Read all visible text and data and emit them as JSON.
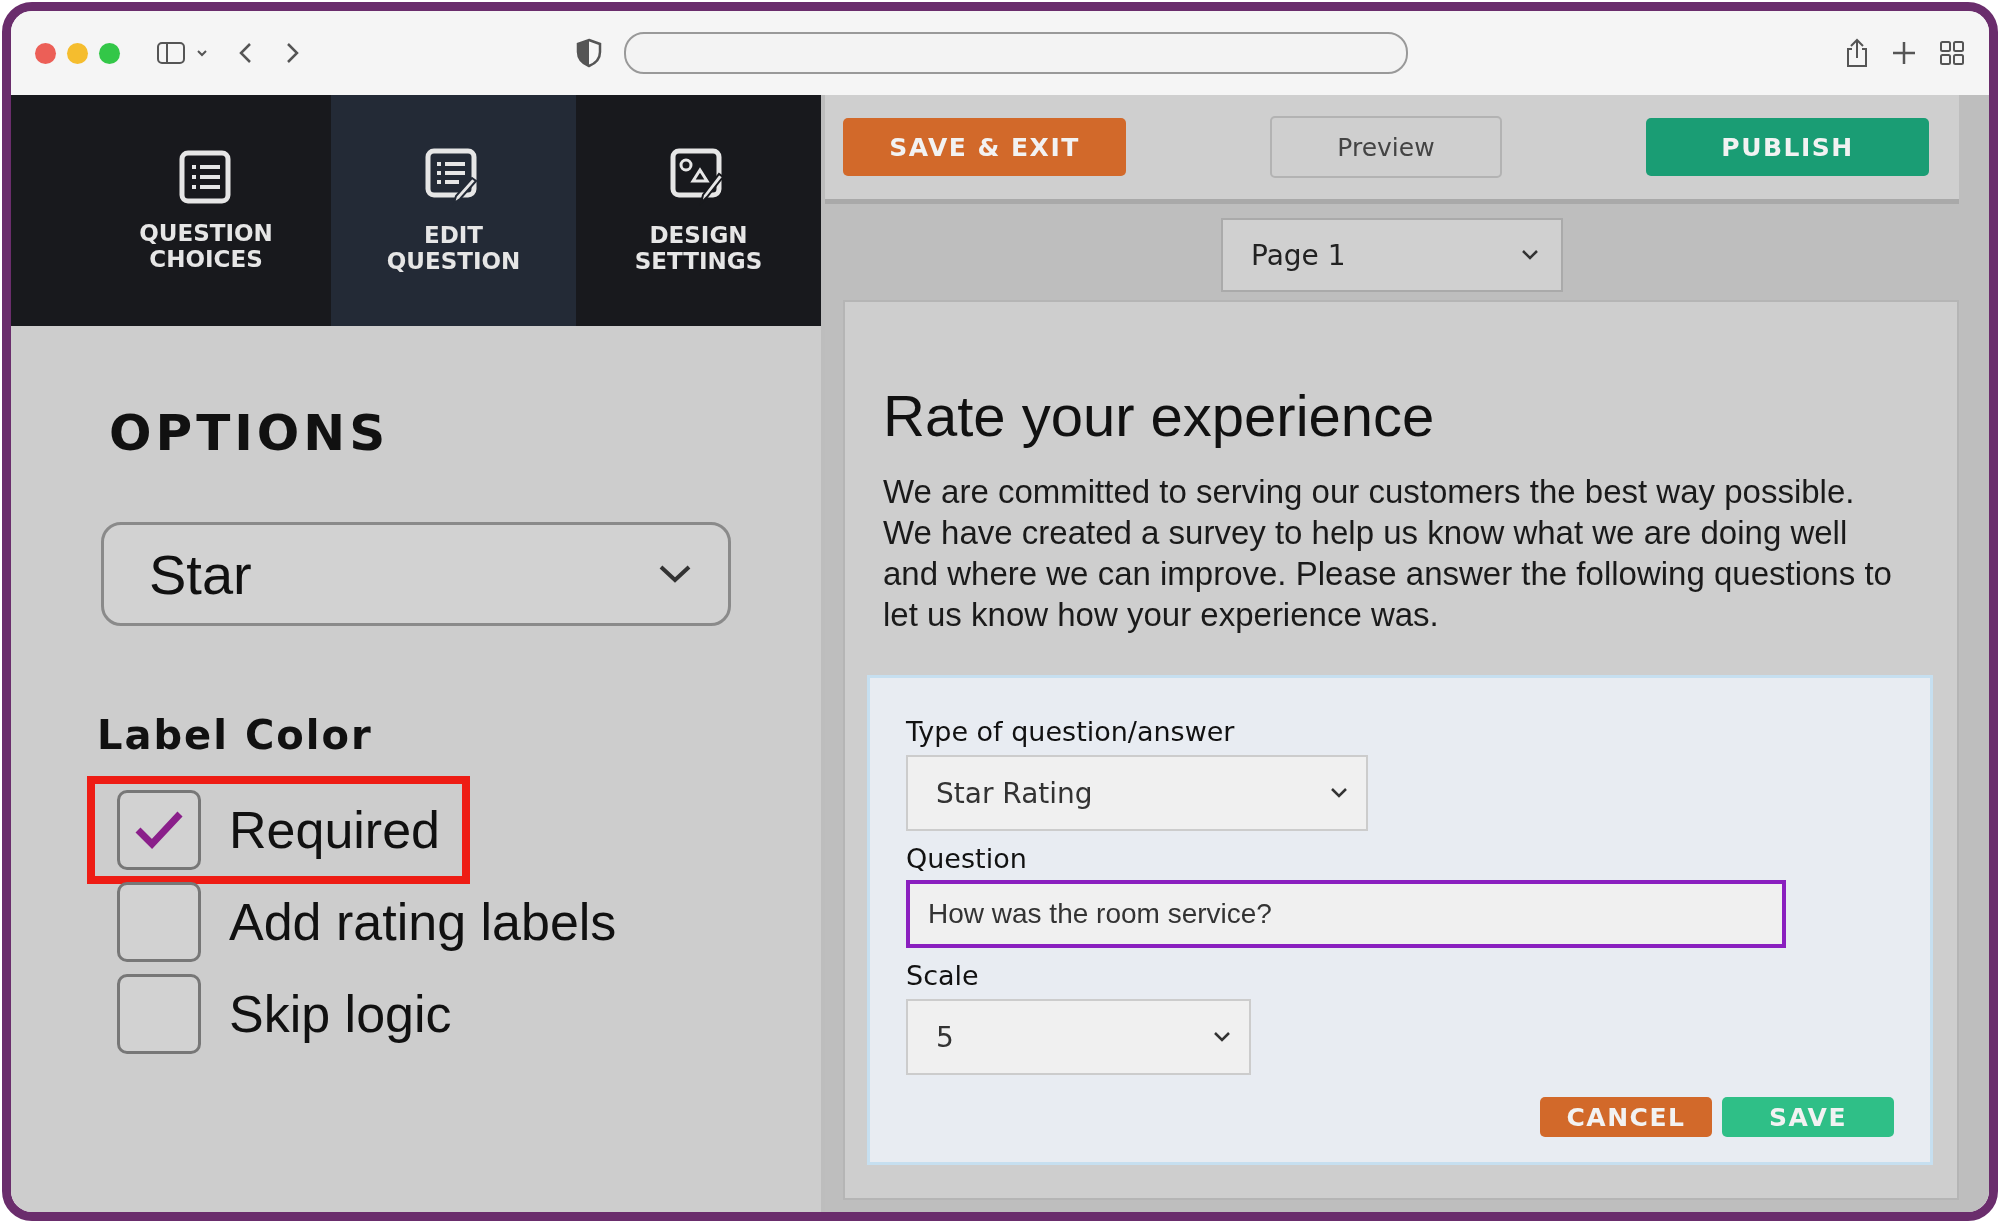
{
  "tabs": [
    {
      "label": "QUESTION CHOICES",
      "kind": "list",
      "selected": false
    },
    {
      "label": "EDIT QUESTION",
      "kind": "edit",
      "selected": true
    },
    {
      "label": "DESIGN SETTINGS",
      "kind": "design",
      "selected": false
    }
  ],
  "options": {
    "title": "OPTIONS",
    "type_select": "Star",
    "label_color_heading": "Label Color",
    "checkboxes": [
      {
        "label": "Required",
        "checked": true,
        "highlighted": true
      },
      {
        "label": "Add rating labels",
        "checked": false,
        "highlighted": false
      },
      {
        "label": "Skip logic",
        "checked": false,
        "highlighted": false
      }
    ]
  },
  "toolbar": {
    "save_exit": "SAVE & EXIT",
    "preview": "Preview",
    "publish": "PUBLISH"
  },
  "page_select": "Page 1",
  "survey": {
    "title": "Rate your experience",
    "description": "We are committed to serving our customers the best way possible. We have created a survey to help us know what we are doing well and where we can improve. Please answer the following questions to let us know how your experience was.",
    "form": {
      "type_label": "Type of question/answer",
      "type_value": "Star Rating",
      "question_label": "Question",
      "question_value": "How was the room service?",
      "scale_label": "Scale",
      "scale_value": "5",
      "cancel": "CANCEL",
      "save": "SAVE"
    }
  }
}
